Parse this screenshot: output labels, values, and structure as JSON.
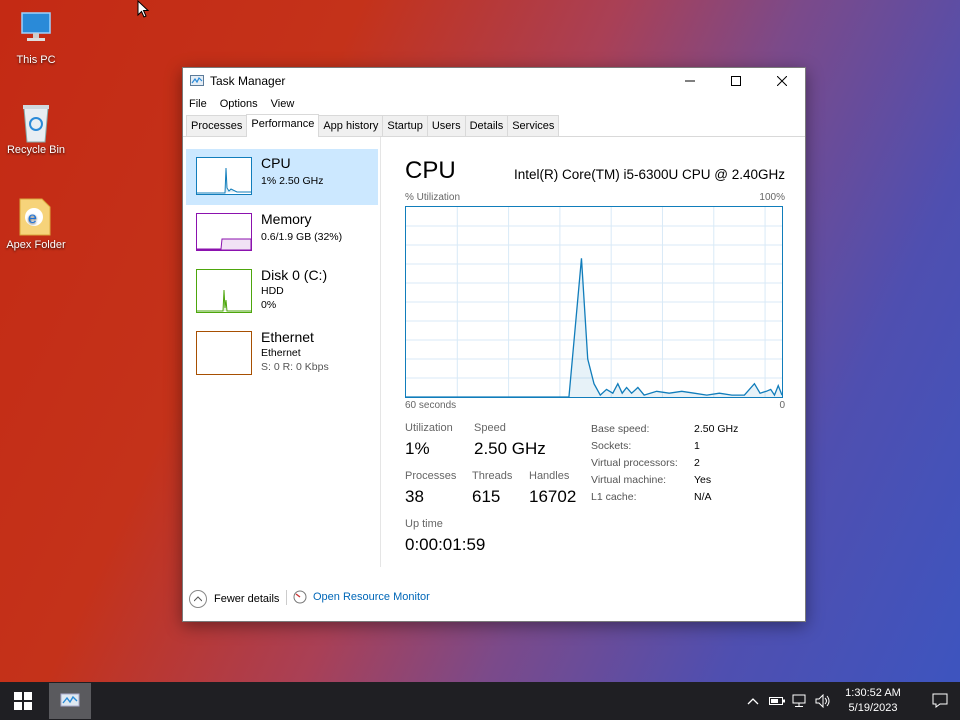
{
  "desktop": {
    "icons": [
      {
        "label": "This PC",
        "icon": "computer-icon"
      },
      {
        "label": "Recycle Bin",
        "icon": "recycle-bin-icon"
      },
      {
        "label": "Apex Folder",
        "icon": "folder-icon"
      }
    ]
  },
  "window": {
    "title": "Task Manager",
    "menu": [
      "File",
      "Options",
      "View"
    ],
    "tabs": [
      "Processes",
      "Performance",
      "App history",
      "Startup",
      "Users",
      "Details",
      "Services"
    ],
    "active_tab": "Performance"
  },
  "sidebar": {
    "items": [
      {
        "title": "CPU",
        "sub1": "1% 2.50 GHz",
        "sub2": "",
        "color": "#117dbb"
      },
      {
        "title": "Memory",
        "sub1": "0.6/1.9 GB (32%)",
        "sub2": "",
        "color": "#8b12ae"
      },
      {
        "title": "Disk 0 (C:)",
        "sub1": "HDD",
        "sub2": "0%",
        "color": "#4da60c"
      },
      {
        "title": "Ethernet",
        "sub1": "Ethernet",
        "sub2": "S: 0 R: 0 Kbps",
        "color": "#a74f01"
      }
    ]
  },
  "cpu": {
    "heading": "CPU",
    "model": "Intel(R) Core(TM) i5-6300U CPU @ 2.40GHz",
    "util_label": "% Utilization",
    "max_label": "100%",
    "time_label": "60 seconds",
    "zero_label": "0",
    "stats": {
      "utilization_label": "Utilization",
      "utilization": "1%",
      "speed_label": "Speed",
      "speed": "2.50 GHz",
      "processes_label": "Processes",
      "processes": "38",
      "threads_label": "Threads",
      "threads": "615",
      "handles_label": "Handles",
      "handles": "16702",
      "uptime_label": "Up time",
      "uptime": "0:00:01:59"
    },
    "details": [
      {
        "label": "Base speed:",
        "value": "2.50 GHz"
      },
      {
        "label": "Sockets:",
        "value": "1"
      },
      {
        "label": "Virtual processors:",
        "value": "2"
      },
      {
        "label": "Virtual machine:",
        "value": "Yes"
      },
      {
        "label": "L1 cache:",
        "value": "N/A"
      }
    ]
  },
  "chart_data": {
    "type": "area",
    "x": [
      60,
      58,
      56,
      54,
      52,
      50,
      48,
      46,
      44,
      42,
      40,
      38,
      36,
      34,
      32,
      30,
      28,
      26,
      24,
      22,
      20,
      18,
      16,
      14,
      12,
      10,
      8,
      6,
      4,
      2,
      0
    ],
    "values": [
      0,
      0,
      0,
      0,
      0,
      0,
      0,
      0,
      0,
      0,
      0,
      0,
      0,
      0,
      0,
      0,
      0,
      0,
      0,
      0,
      0,
      0,
      0,
      0,
      0,
      0,
      0,
      0,
      0,
      0,
      0
    ],
    "series": [
      {
        "values_pct": [
          0,
          0,
          0,
          0,
          0,
          0,
          0,
          0,
          0,
          0,
          0,
          0,
          0,
          0,
          0,
          0,
          0,
          0,
          0,
          0,
          0,
          0,
          0,
          0,
          0,
          0,
          0,
          0,
          0,
          0,
          0
        ]
      }
    ],
    "points": [
      [
        60,
        0
      ],
      [
        34,
        0
      ],
      [
        32,
        73
      ],
      [
        31,
        20
      ],
      [
        30,
        7
      ],
      [
        29,
        1
      ],
      [
        28,
        4
      ],
      [
        27,
        2
      ],
      [
        26.2,
        7
      ],
      [
        25.5,
        2
      ],
      [
        24.8,
        5
      ],
      [
        24,
        2
      ],
      [
        23,
        5
      ],
      [
        22,
        1
      ],
      [
        20,
        3
      ],
      [
        18,
        2
      ],
      [
        16,
        3
      ],
      [
        14,
        2
      ],
      [
        12,
        1
      ],
      [
        10,
        2
      ],
      [
        8,
        1
      ],
      [
        6,
        1
      ],
      [
        4.4,
        7
      ],
      [
        3.5,
        2
      ],
      [
        2.5,
        3
      ],
      [
        1.8,
        4
      ],
      [
        1.2,
        1
      ],
      [
        0.6,
        6
      ],
      [
        0,
        1
      ]
    ],
    "ylim": [
      0,
      100
    ],
    "xlim": [
      60,
      0
    ],
    "color": "#117dbb"
  },
  "footer": {
    "fewer_details": "Fewer details",
    "open_resource_monitor": "Open Resource Monitor"
  },
  "taskbar": {
    "time": "1:30:52 AM",
    "date": "5/19/2023"
  }
}
